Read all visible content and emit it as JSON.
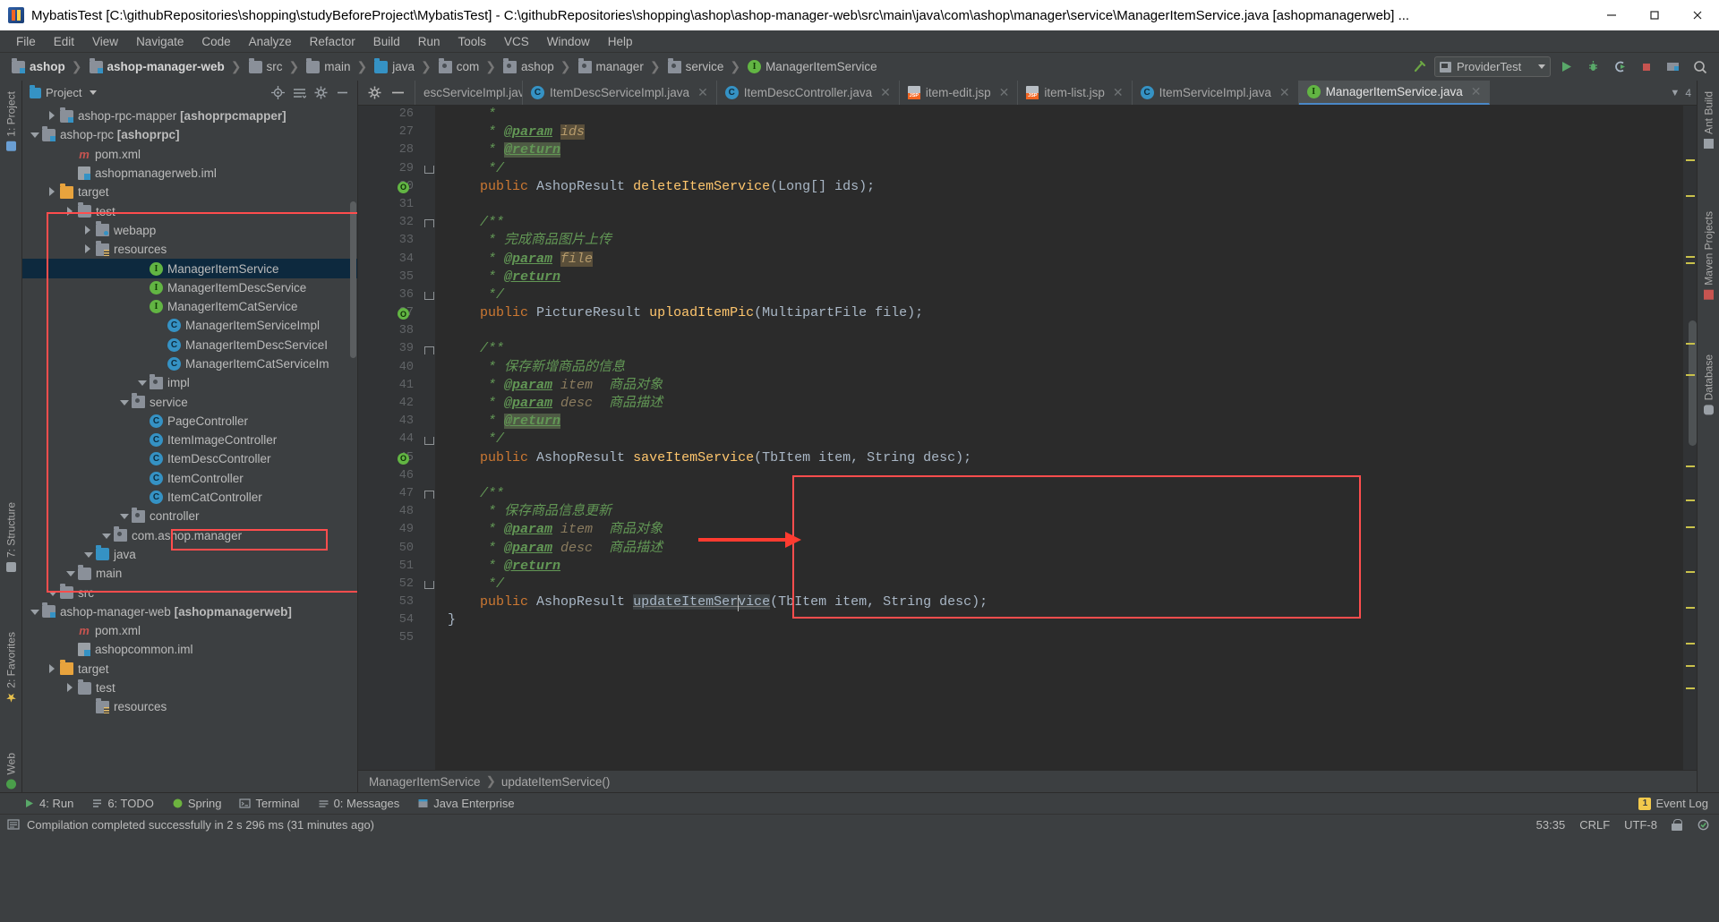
{
  "window": {
    "title": "MybatisTest [C:\\githubRepositories\\shopping\\studyBeforeProject\\MybatisTest] - C:\\githubRepositories\\shopping\\ashop\\ashop-manager-web\\src\\main\\java\\com\\ashop\\manager\\service\\ManagerItemService.java [ashopmanagerweb] ...",
    "minimize": "─",
    "maximize": "❑",
    "close": "✕"
  },
  "menubar": {
    "items": [
      "File",
      "Edit",
      "View",
      "Navigate",
      "Code",
      "Analyze",
      "Refactor",
      "Build",
      "Run",
      "Tools",
      "VCS",
      "Window",
      "Help"
    ]
  },
  "navbar": {
    "crumbs": [
      {
        "label": "ashop",
        "icon": "module-folder-icon",
        "bold": true
      },
      {
        "label": "ashop-manager-web",
        "icon": "module-folder-icon",
        "bold": true
      },
      {
        "label": "src",
        "icon": "folder-icon",
        "bold": false
      },
      {
        "label": "main",
        "icon": "folder-icon",
        "bold": false
      },
      {
        "label": "java",
        "icon": "source-folder-icon",
        "bold": false
      },
      {
        "label": "com",
        "icon": "package-icon",
        "bold": false
      },
      {
        "label": "ashop",
        "icon": "package-icon",
        "bold": false
      },
      {
        "label": "manager",
        "icon": "package-icon",
        "bold": false
      },
      {
        "label": "service",
        "icon": "package-icon",
        "bold": false
      },
      {
        "label": "ManagerItemService",
        "icon": "interface-icon",
        "bold": false
      }
    ],
    "run_config": "ProviderTest"
  },
  "project_panel": {
    "title": "Project",
    "tree": [
      {
        "label": "resources",
        "indent": 3,
        "arrow": "none",
        "icon": "resources-folder-icon",
        "selected": false
      },
      {
        "label": "test",
        "indent": 2,
        "arrow": "right",
        "icon": "folder-icon",
        "selected": false
      },
      {
        "label": "target",
        "indent": 1,
        "arrow": "right",
        "icon": "target-folder-icon",
        "selected": false
      },
      {
        "label": "ashopcommon.iml",
        "indent": 2,
        "arrow": "none",
        "icon": "iml-file-icon",
        "selected": false
      },
      {
        "label": "pom.xml",
        "indent": 2,
        "arrow": "none",
        "icon": "maven-file-icon",
        "selected": false
      },
      {
        "label": "ashop-manager-web [ashopmanagerweb]",
        "indent": 0,
        "arrow": "down",
        "icon": "module-folder-icon",
        "selected": false,
        "bold_suffix": "[ashopmanagerweb]"
      },
      {
        "label": "src",
        "indent": 1,
        "arrow": "down",
        "icon": "folder-icon",
        "selected": false
      },
      {
        "label": "main",
        "indent": 2,
        "arrow": "down",
        "icon": "folder-icon",
        "selected": false
      },
      {
        "label": "java",
        "indent": 3,
        "arrow": "down",
        "icon": "source-folder-icon",
        "selected": false
      },
      {
        "label": "com.ashop.manager",
        "indent": 4,
        "arrow": "down",
        "icon": "package-icon",
        "selected": false
      },
      {
        "label": "controller",
        "indent": 5,
        "arrow": "down",
        "icon": "package-icon",
        "selected": false
      },
      {
        "label": "ItemCatController",
        "indent": 6,
        "arrow": "none",
        "icon": "class-icon",
        "selected": false
      },
      {
        "label": "ItemController",
        "indent": 6,
        "arrow": "none",
        "icon": "class-icon",
        "selected": false
      },
      {
        "label": "ItemDescController",
        "indent": 6,
        "arrow": "none",
        "icon": "class-icon",
        "selected": false
      },
      {
        "label": "ItemImageController",
        "indent": 6,
        "arrow": "none",
        "icon": "class-icon",
        "selected": false
      },
      {
        "label": "PageController",
        "indent": 6,
        "arrow": "none",
        "icon": "class-icon",
        "selected": false
      },
      {
        "label": "service",
        "indent": 5,
        "arrow": "down",
        "icon": "package-icon",
        "selected": false
      },
      {
        "label": "impl",
        "indent": 6,
        "arrow": "down",
        "icon": "package-icon",
        "selected": false
      },
      {
        "label": "ManagerItemCatServiceIm",
        "indent": 7,
        "arrow": "none",
        "icon": "class-icon",
        "selected": false
      },
      {
        "label": "ManagerItemDescServiceI",
        "indent": 7,
        "arrow": "none",
        "icon": "class-icon",
        "selected": false
      },
      {
        "label": "ManagerItemServiceImpl",
        "indent": 7,
        "arrow": "none",
        "icon": "class-icon",
        "selected": false
      },
      {
        "label": "ManagerItemCatService",
        "indent": 6,
        "arrow": "none",
        "icon": "interface-icon",
        "selected": false
      },
      {
        "label": "ManagerItemDescService",
        "indent": 6,
        "arrow": "none",
        "icon": "interface-icon",
        "selected": false
      },
      {
        "label": "ManagerItemService",
        "indent": 6,
        "arrow": "none",
        "icon": "interface-icon",
        "selected": true
      },
      {
        "label": "resources",
        "indent": 3,
        "arrow": "right",
        "icon": "resources-folder-icon",
        "selected": false
      },
      {
        "label": "webapp",
        "indent": 3,
        "arrow": "right",
        "icon": "webapp-folder-icon",
        "selected": false
      },
      {
        "label": "test",
        "indent": 2,
        "arrow": "right",
        "icon": "folder-icon",
        "selected": false
      },
      {
        "label": "target",
        "indent": 1,
        "arrow": "right",
        "icon": "target-folder-icon",
        "selected": false
      },
      {
        "label": "ashopmanagerweb.iml",
        "indent": 2,
        "arrow": "none",
        "icon": "iml-file-icon",
        "selected": false
      },
      {
        "label": "pom.xml",
        "indent": 2,
        "arrow": "none",
        "icon": "maven-file-icon",
        "selected": false
      },
      {
        "label": "ashop-rpc [ashoprpc]",
        "indent": 0,
        "arrow": "down",
        "icon": "module-folder-icon",
        "selected": false,
        "bold_suffix": "[ashoprpc]"
      },
      {
        "label": "ashop-rpc-mapper [ashoprpcmapper]",
        "indent": 1,
        "arrow": "right",
        "icon": "module-folder-icon",
        "selected": false,
        "bold_suffix": "[ashoprpcmapper]"
      }
    ]
  },
  "left_rail": {
    "tabs": [
      "1: Project",
      "7: Structure",
      "2: Favorites",
      "Web"
    ]
  },
  "right_rail": {
    "tabs": [
      "Ant Build",
      "Maven Projects",
      "Database"
    ]
  },
  "editor": {
    "tabs": [
      {
        "label": "escServiceImpl.java",
        "icon": "class-icon",
        "active": false,
        "clipped": true
      },
      {
        "label": "ItemDescServiceImpl.java",
        "icon": "class-icon",
        "active": false
      },
      {
        "label": "ItemDescController.java",
        "icon": "class-icon",
        "active": false
      },
      {
        "label": "item-edit.jsp",
        "icon": "jsp-file-icon",
        "active": false
      },
      {
        "label": "item-list.jsp",
        "icon": "jsp-file-icon",
        "active": false
      },
      {
        "label": "ItemServiceImpl.java",
        "icon": "class-icon",
        "active": false
      },
      {
        "label": "ManagerItemService.java",
        "icon": "interface-icon",
        "active": true
      }
    ],
    "tab_overflow": "4",
    "first_line_number": 26,
    "lines": [
      {
        "n": 26,
        "text": "     *",
        "type": "comment"
      },
      {
        "n": 27,
        "text": "     * @param ids",
        "type": "comment-param",
        "tagText": "@param",
        "paramText": "ids",
        "paramHL": true
      },
      {
        "n": 28,
        "text": "     * @return",
        "type": "comment-tag",
        "tagText": "@return",
        "tagHL": true
      },
      {
        "n": 29,
        "text": "     */",
        "type": "comment"
      },
      {
        "n": 30,
        "text": "    public AshopResult deleteItemService(Long[] ids);",
        "type": "signature"
      },
      {
        "n": 31,
        "text": "",
        "type": "blank"
      },
      {
        "n": 32,
        "text": "    /**",
        "type": "comment"
      },
      {
        "n": 33,
        "text": "     * 完成商品图片上传",
        "type": "comment"
      },
      {
        "n": 34,
        "text": "     * @param file",
        "type": "comment-param",
        "tagText": "@param",
        "paramText": "file",
        "paramHL": true
      },
      {
        "n": 35,
        "text": "     * @return",
        "type": "comment-tag",
        "tagText": "@return",
        "tagHL": false
      },
      {
        "n": 36,
        "text": "     */",
        "type": "comment"
      },
      {
        "n": 37,
        "text": "    public PictureResult uploadItemPic(MultipartFile file);",
        "type": "signature"
      },
      {
        "n": 38,
        "text": "",
        "type": "blank"
      },
      {
        "n": 39,
        "text": "    /**",
        "type": "comment"
      },
      {
        "n": 40,
        "text": "     * 保存新增商品的信息",
        "type": "comment"
      },
      {
        "n": 41,
        "text": "     * @param item 商品对象",
        "type": "comment-param",
        "tagText": "@param",
        "paramText": "item",
        "desc": "商品对象"
      },
      {
        "n": 42,
        "text": "     * @param desc 商品描述",
        "type": "comment-param",
        "tagText": "@param",
        "paramText": "desc",
        "desc": "商品描述"
      },
      {
        "n": 43,
        "text": "     * @return",
        "type": "comment-tag",
        "tagText": "@return",
        "tagHL": true
      },
      {
        "n": 44,
        "text": "     */",
        "type": "comment"
      },
      {
        "n": 45,
        "text": "    public AshopResult saveItemService(TbItem item, String desc);",
        "type": "signature"
      },
      {
        "n": 46,
        "text": "",
        "type": "blank"
      },
      {
        "n": 47,
        "text": "    /**",
        "type": "comment"
      },
      {
        "n": 48,
        "text": "     * 保存商品信息更新",
        "type": "comment"
      },
      {
        "n": 49,
        "text": "     * @param item 商品对象",
        "type": "comment-param",
        "tagText": "@param",
        "paramText": "item",
        "desc": "商品对象"
      },
      {
        "n": 50,
        "text": "     * @param desc 商品描述",
        "type": "comment-param",
        "tagText": "@param",
        "paramText": "desc",
        "desc": "商品描述"
      },
      {
        "n": 51,
        "text": "     * @return",
        "type": "comment-tag",
        "tagText": "@return",
        "tagHL": false
      },
      {
        "n": 52,
        "text": "     */",
        "type": "comment"
      },
      {
        "n": 53,
        "text": "    public AshopResult updateItemService(TbItem item, String desc);",
        "type": "signature-underline"
      },
      {
        "n": 54,
        "text": "}",
        "type": "code"
      },
      {
        "n": 55,
        "text": "",
        "type": "blank"
      }
    ],
    "breadcrumb": [
      "ManagerItemService",
      "updateItemService()"
    ]
  },
  "bottom_bar": {
    "items": [
      {
        "label": "4: Run",
        "icon": "run-icon"
      },
      {
        "label": "6: TODO",
        "icon": "todo-icon"
      },
      {
        "label": "Spring",
        "icon": "spring-icon"
      },
      {
        "label": "Terminal",
        "icon": "terminal-icon"
      },
      {
        "label": "0: Messages",
        "icon": "messages-icon"
      },
      {
        "label": "Java Enterprise",
        "icon": "java-ee-icon"
      }
    ],
    "event_log": "Event Log",
    "event_count": "1"
  },
  "status_bar": {
    "message": "Compilation completed successfully in 2 s 296 ms (31 minutes ago)",
    "caret_position": "53:35",
    "line_separator": "CRLF",
    "encoding": "UTF-8"
  },
  "colors": {
    "accent_blue": "#4a88c7",
    "selection": "#0d293e",
    "annotation_red": "#ff4d4d",
    "editor_bg": "#2b2b2b",
    "panel_bg": "#3c3f41"
  }
}
